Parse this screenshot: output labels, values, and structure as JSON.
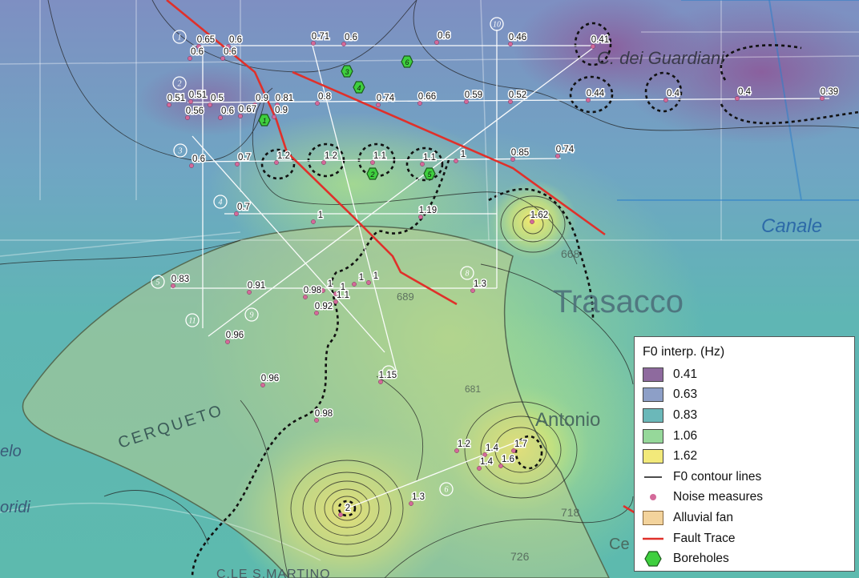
{
  "map": {
    "place_labels": {
      "trasacco": "Trasacco",
      "canale": "Canale",
      "guardiani": "C. dei Guardiani",
      "cerqueto": "CERQUETO",
      "antonio": "Antonio",
      "martino": "C.LE S.MARTINO",
      "elo": "elo",
      "oridi": "oridi",
      "ce": "Ce",
      "n689": "689",
      "n668": "668",
      "n726": "726",
      "n718": "718",
      "n681": "681"
    },
    "profiles": [
      "1",
      "2",
      "3",
      "4",
      "5",
      "6",
      "7",
      "8",
      "9",
      "10",
      "11"
    ],
    "boreholes": [
      "1",
      "2",
      "3",
      "4",
      "5",
      "6"
    ],
    "f0_values": [
      "0.65",
      "0.6",
      "0.6",
      "0.6",
      "0.71",
      "0.6",
      "0.6",
      "0.46",
      "0.41",
      "0.51",
      "0.51",
      "0.5",
      "0.56",
      "0.6",
      "0.67",
      "0.9",
      "0.81",
      "0.9",
      "0.8",
      "0.74",
      "0.66",
      "0.59",
      "0.52",
      "0.44",
      "0.4",
      "0.4",
      "0.39",
      "0.6",
      "0.7",
      "1.2",
      "1.2",
      "1.1",
      "1.1",
      "1",
      "0.85",
      "0.74",
      "0.7",
      "1",
      "1.19",
      "1.62",
      "0.83",
      "0.91",
      "0.98",
      "1",
      "1",
      "1",
      "1",
      "1.1",
      "0.92",
      "1.3",
      "0.96",
      "0.96",
      "0.98",
      "1.15",
      "1.2",
      "1.4",
      "1.4",
      "1.7",
      "1.6",
      "1.3",
      "2"
    ]
  },
  "legend": {
    "title": "F0 interp. (Hz)",
    "classes": [
      {
        "label": "0.41",
        "color": "#8e6a9e"
      },
      {
        "label": "0.63",
        "color": "#8d9fc7"
      },
      {
        "label": "0.83",
        "color": "#6bb8b9"
      },
      {
        "label": "1.06",
        "color": "#96d89a"
      },
      {
        "label": "1.62",
        "color": "#f2e97a"
      }
    ],
    "items": {
      "contour": "F0 contour lines",
      "noise": "Noise measures",
      "fan": "Alluvial fan",
      "fault": "Fault Trace",
      "boreholes": "Boreholes"
    },
    "colors": {
      "noise": "#d46a9a",
      "fan": "#f3d39c",
      "fault": "#e0302a",
      "borehole": "#3ecf3e"
    }
  }
}
